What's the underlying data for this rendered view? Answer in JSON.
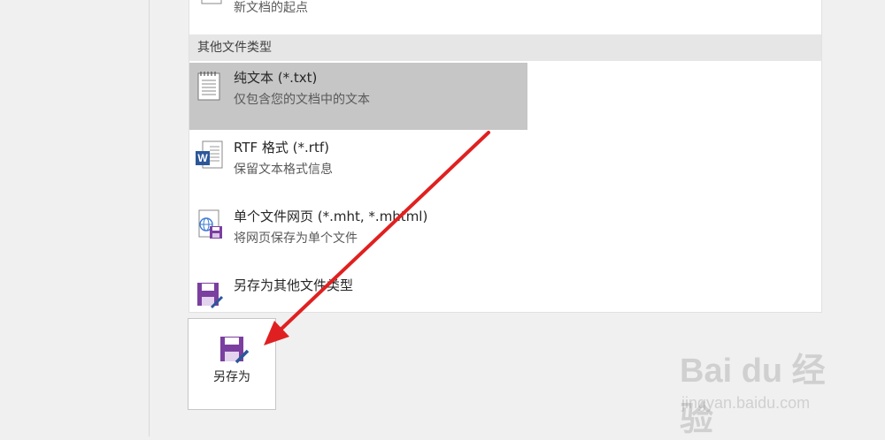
{
  "top_item": {
    "desc": "新文档的起点"
  },
  "section": {
    "title": "其他文件类型"
  },
  "file_types": [
    {
      "title": "纯文本 (*.txt)",
      "desc": "仅包含您的文档中的文本",
      "icon": "text-file-icon"
    },
    {
      "title": "RTF 格式 (*.rtf)",
      "desc": "保留文本格式信息",
      "icon": "word-rtf-icon"
    },
    {
      "title": "单个文件网页 (*.mht, *.mhtml)",
      "desc": "将网页保存为单个文件",
      "icon": "webpage-save-icon"
    },
    {
      "title": "另存为其他文件类型",
      "desc": "",
      "icon": "save-as-icon"
    }
  ],
  "save_as_button": {
    "label": "另存为",
    "icon": "save-as-icon"
  },
  "watermark": {
    "brand": "Bai du 经验",
    "url": "jingyan.baidu.com"
  },
  "colors": {
    "selected_bg": "#c6c6c6",
    "arrow": "#e02020",
    "accent_purple": "#7b3fa0"
  }
}
